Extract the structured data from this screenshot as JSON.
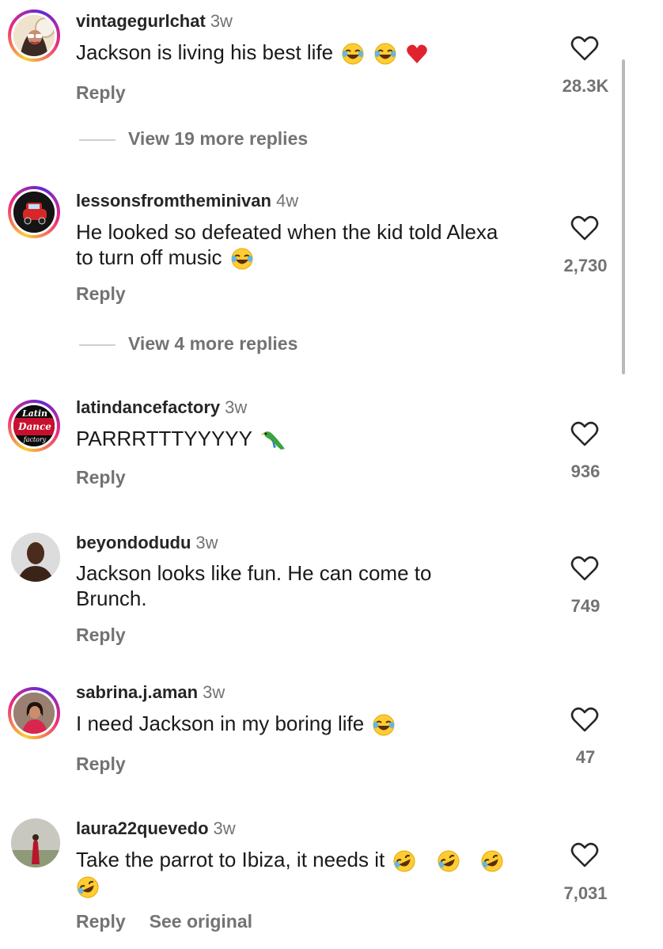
{
  "comments": [
    {
      "username": "vintagegurlchat",
      "time": "3w",
      "text": "Jackson is living his best life",
      "emojis": [
        "laughing-emoji",
        "laughing-emoji",
        "red-heart-emoji"
      ],
      "reply_label": "Reply",
      "likes": "28.3K",
      "view_more": "View 19 more replies",
      "story_ring": true
    },
    {
      "username": "lessonsfromtheminivan",
      "time": "4w",
      "text": "He looked so defeated when the kid told Alexa to turn off music",
      "emojis": [
        "laughing-emoji"
      ],
      "reply_label": "Reply",
      "likes": "2,730",
      "view_more": "View 4 more replies",
      "story_ring": true
    },
    {
      "username": "latindancefactory",
      "time": "3w",
      "text": "PARRRTTTYYYYY",
      "emojis": [
        "parrot-emoji"
      ],
      "reply_label": "Reply",
      "likes": "936",
      "avatar_text": [
        "Latin",
        "Dance",
        "factory"
      ],
      "story_ring": true
    },
    {
      "username": "beyondodudu",
      "time": "3w",
      "text": "Jackson looks like fun. He can come to Brunch.",
      "emojis": [],
      "reply_label": "Reply",
      "likes": "749",
      "story_ring": false
    },
    {
      "username": "sabrina.j.aman",
      "time": "3w",
      "text": "I need Jackson in my boring life",
      "emojis": [
        "laughing-emoji"
      ],
      "reply_label": "Reply",
      "likes": "47",
      "story_ring": true
    },
    {
      "username": "laura22quevedo",
      "time": "3w",
      "text": "Take the parrot to Ibiza, it needs it",
      "emojis": [
        "rolling-laughing-emoji",
        "rolling-laughing-emoji",
        "rolling-laughing-emoji",
        "rolling-laughing-emoji"
      ],
      "reply_label": "Reply",
      "see_original": "See original",
      "likes": "7,031",
      "story_ring": false
    }
  ],
  "colors": {
    "muted": "#737373",
    "username": "#262626",
    "heart_stroke": "#262626"
  }
}
